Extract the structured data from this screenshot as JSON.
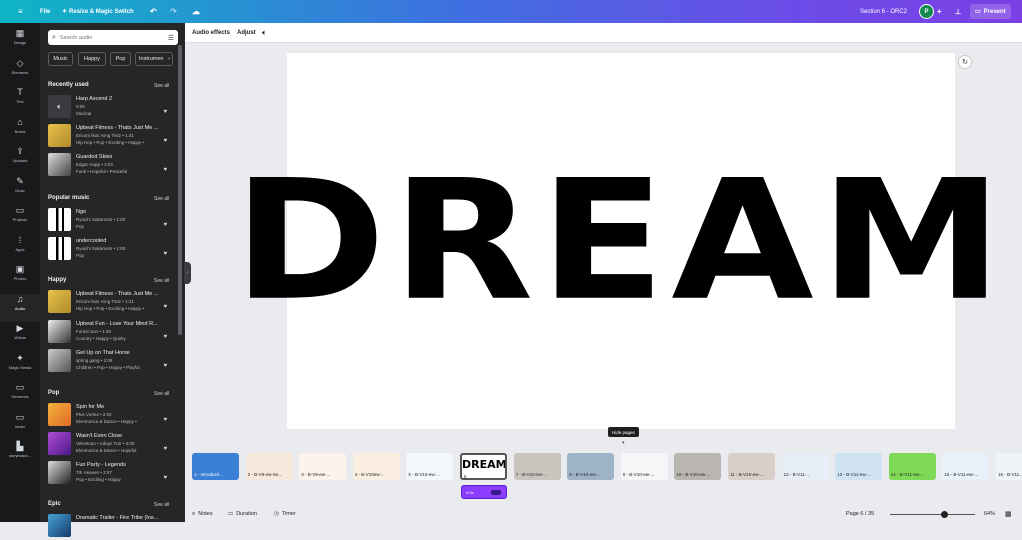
{
  "topbar": {
    "menu_icon": "hamburger-icon",
    "file": "File",
    "resize": "Resize & Magic Switch",
    "title": "Section 6 - ORC2",
    "avatar": "P",
    "present": "Present"
  },
  "rail": [
    {
      "label": "Design",
      "icon": "▦"
    },
    {
      "label": "Elements",
      "icon": "◇"
    },
    {
      "label": "Text",
      "icon": "T"
    },
    {
      "label": "Brand",
      "icon": "⌂"
    },
    {
      "label": "Uploads",
      "icon": "⇪"
    },
    {
      "label": "Draw",
      "icon": "✎"
    },
    {
      "label": "Projects",
      "icon": "▭"
    },
    {
      "label": "Apps",
      "icon": "⁞"
    },
    {
      "label": "Photos",
      "icon": "▣"
    },
    {
      "label": "Audio",
      "icon": "♫"
    },
    {
      "label": "Videos",
      "icon": "▶"
    },
    {
      "label": "Magic Media",
      "icon": "✦"
    },
    {
      "label": "Genemes",
      "icon": "▭"
    },
    {
      "label": "music",
      "icon": "▭"
    },
    {
      "label": "storyboard...",
      "icon": "▙"
    }
  ],
  "panel": {
    "search_placeholder": "Search audio",
    "chips": [
      "Music",
      "Happy",
      "Pop",
      "Instrumen"
    ],
    "see_all": "See all",
    "sections": [
      {
        "title": "Recently used",
        "tracks": [
          {
            "name": "Harp Ascend 2",
            "meta": "0:05",
            "genre": "Musical"
          },
          {
            "name": "Upbeat Fitness - Thats Just Me ...",
            "meta": "Ericom feat. King Tintz • 1:41",
            "genre": "Hip Hop • Pop • Exciting • Happy •"
          },
          {
            "name": "Guarded Skies",
            "meta": "Edgar Hopp • 3:03",
            "genre": "Funk • Hopeful • Peaceful"
          }
        ]
      },
      {
        "title": "Popular music",
        "tracks": [
          {
            "name": "Ngo",
            "meta": "Ryuichi Sakamoto • 1:00",
            "genre": "Pop"
          },
          {
            "name": "undercooled",
            "meta": "Ryuichi Sakamoto • 1:00",
            "genre": "Pop"
          }
        ]
      },
      {
        "title": "Happy",
        "tracks": [
          {
            "name": "Upbeat Fitness - Thats Just Me ...",
            "meta": "Ericom feat. King Tintz • 1:41",
            "genre": "Hip Hop • Pop • Exciting • Happy •"
          },
          {
            "name": "Upbeat Fun - Lose Your Mind R...",
            "meta": "Forest Sun • 1:38",
            "genre": "Country • Happy • Quirky"
          },
          {
            "name": "Get Up on That Horse",
            "meta": "spring gang • 2:09",
            "genre": "Children • Pop • Happy • Playful"
          }
        ]
      },
      {
        "title": "Pop",
        "tracks": [
          {
            "name": "Spin for Me",
            "meta": "Plus Vortex • 2:04",
            "genre": "Electronica & Dance • Happy •"
          },
          {
            "name": "Wasn't Even Close",
            "meta": "Velvetoon • Aduyn Turr • 3:00",
            "genre": "Electronica & Dance • Hopeful"
          },
          {
            "name": "Fun Party - Legends",
            "meta": "7th Heaven • 2:07",
            "genre": "Pop • Exciting • Happy"
          }
        ]
      },
      {
        "title": "Epic",
        "tracks": [
          {
            "name": "Dramatic Trailer - Fire Tribe (Ins...",
            "meta": "",
            "genre": ""
          }
        ]
      }
    ]
  },
  "context": {
    "audio_effects": "Audio effects",
    "adjust": "Adjust"
  },
  "canvas": {
    "text": "DREAM"
  },
  "tooltip": "Hide pages",
  "pages": [
    {
      "label": "1 - Introducti...",
      "color": "#3b7fd6"
    },
    {
      "label": "2 - B-V9-ew-Se...",
      "color": "#f7e8dc"
    },
    {
      "label": "3 - B-V9-ew-...",
      "color": "#fdf3ea"
    },
    {
      "label": "4 - B-V10ew-...",
      "color": "#f9eedf"
    },
    {
      "label": "5 - B-V10-ew-...",
      "color": "#f4f7fb"
    },
    {
      "label": "6",
      "color": "#ffffff"
    },
    {
      "label": "7 - B-V10-ew-...",
      "color": "#c9c4be"
    },
    {
      "label": "8 - B-V10-ew-...",
      "color": "#9fb3c8"
    },
    {
      "label": "9 - B-V10-ew-...",
      "color": "#f5f6f8"
    },
    {
      "label": "10 - B-V10-ew-...",
      "color": "#b9b6b2"
    },
    {
      "label": "11 - B-V10-ew-...",
      "color": "#d7cfc8"
    },
    {
      "label": "12 - B-V11-...",
      "color": "#e7eef7"
    },
    {
      "label": "13 - B-V11-ew-...",
      "color": "#cfe3f3"
    },
    {
      "label": "14 - B-V11-ew-...",
      "color": "#7ed957"
    },
    {
      "label": "15 - B-V11-ew-...",
      "color": "#e8f0fa"
    },
    {
      "label": "16 - B-V11...",
      "color": "#eef3f8"
    }
  ],
  "audio_clip": {
    "time": "0:0s"
  },
  "bottom": {
    "notes": "Notes",
    "duration": "Duration",
    "timer": "Timer",
    "page_indicator": "Page 6 / 35",
    "zoom_level": 0.64,
    "zoom": "64%"
  }
}
